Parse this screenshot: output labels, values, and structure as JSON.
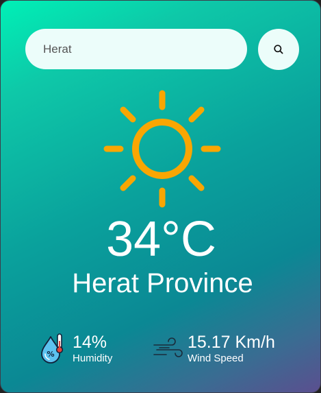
{
  "search": {
    "value": "Herat"
  },
  "weather": {
    "icon": "sun-icon",
    "temperature": "34°C",
    "city": "Herat Province"
  },
  "details": {
    "humidity": {
      "icon": "humidity-icon",
      "value": "14%",
      "label": "Humidity"
    },
    "wind": {
      "icon": "wind-icon",
      "value": "15.17 Km/h",
      "label": "Wind Speed"
    }
  },
  "colors": {
    "gradient_start": "#00f0b6",
    "gradient_mid": "#0a9e9c",
    "gradient_end": "#5b4f8f",
    "sun": "#f9a602",
    "field_background": "#ecfdfa"
  }
}
